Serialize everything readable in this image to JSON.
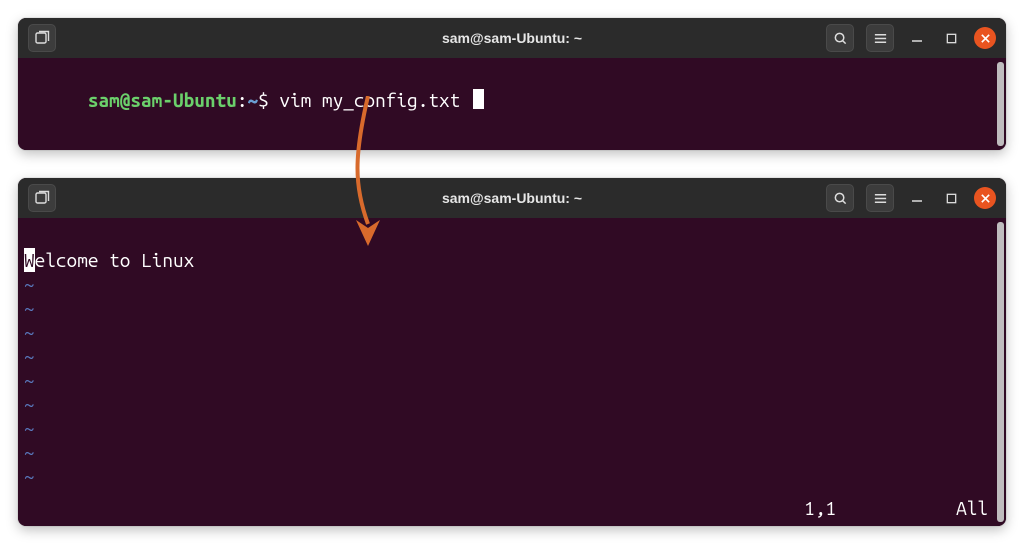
{
  "top_window": {
    "title": "sam@sam-Ubuntu: ~",
    "prompt_userhost": "sam@sam-Ubuntu",
    "prompt_sep": ":",
    "prompt_path": "~",
    "prompt_symbol": "$",
    "command": "vim my_config.txt "
  },
  "bottom_window": {
    "title": "sam@sam-Ubuntu: ~",
    "vim_first_char": "W",
    "vim_rest": "elcome to Linux",
    "vim_tilde": "~",
    "vim_cursor_pos": "1,1",
    "vim_scroll": "All"
  },
  "icons": {
    "newtab": "new-tab-icon",
    "search": "search-icon",
    "menu": "hamburger-icon",
    "min": "minimize-icon",
    "max": "maximize-icon",
    "close": "close-icon"
  }
}
